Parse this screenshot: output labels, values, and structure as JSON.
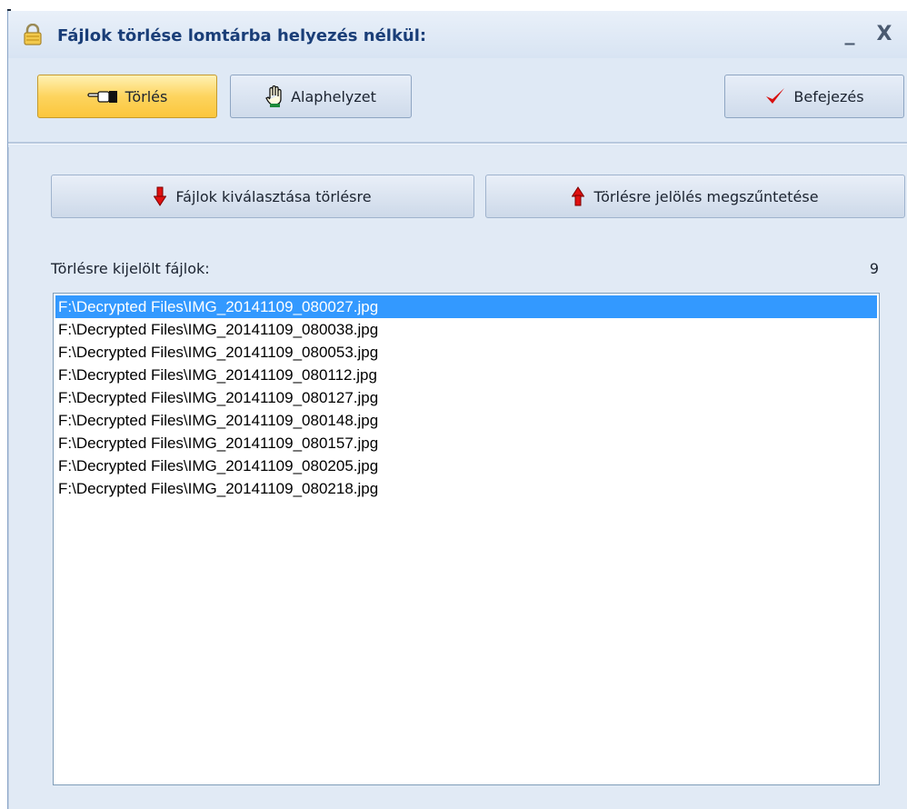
{
  "window": {
    "title": "Fájlok törlése lomtárba helyezés nélkül:",
    "minimize_glyph": "_",
    "close_glyph": "X"
  },
  "toolbar": {
    "delete_label": "Törlés",
    "reset_label": "Alaphelyzet",
    "finish_label": "Befejezés",
    "delete_icon": "pointing-hand-icon",
    "reset_icon": "raised-hand-icon",
    "finish_icon": "checkmark-icon"
  },
  "actions": {
    "select_label": "Fájlok kiválasztása törlésre",
    "unmark_label": "Törlésre jelölés megszűntetése",
    "select_icon": "arrow-down-icon",
    "unmark_icon": "arrow-up-icon"
  },
  "files": {
    "label": "Törlésre kijelölt fájlok:",
    "count": "9",
    "selected_index": 0,
    "items": [
      "F:\\Decrypted Files\\IMG_20141109_080027.jpg",
      "F:\\Decrypted Files\\IMG_20141109_080038.jpg",
      "F:\\Decrypted Files\\IMG_20141109_080053.jpg",
      "F:\\Decrypted Files\\IMG_20141109_080112.jpg",
      "F:\\Decrypted Files\\IMG_20141109_080127.jpg",
      "F:\\Decrypted Files\\IMG_20141109_080148.jpg",
      "F:\\Decrypted Files\\IMG_20141109_080157.jpg",
      "F:\\Decrypted Files\\IMG_20141109_080205.jpg",
      "F:\\Decrypted Files\\IMG_20141109_080218.jpg"
    ]
  },
  "colors": {
    "selection": "#3399ff",
    "active_button": "#fdd45e",
    "title_text": "#1a3e78",
    "arrow_red": "#e01010"
  }
}
